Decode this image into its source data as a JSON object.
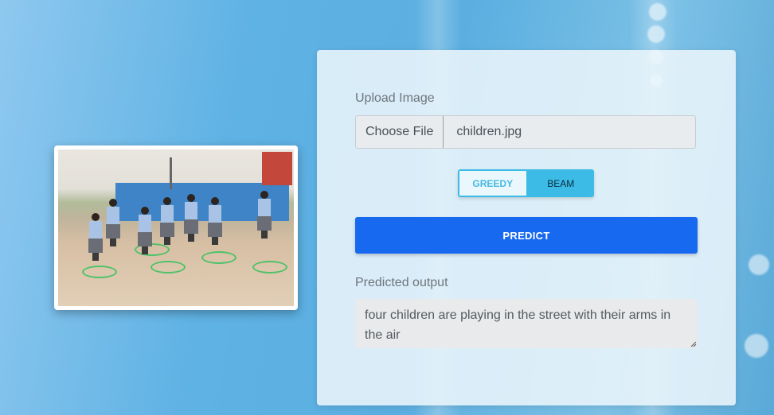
{
  "upload": {
    "label": "Upload Image",
    "button_label": "Choose File",
    "file_name": "children.jpg"
  },
  "mode": {
    "options": [
      "GREEDY",
      "BEAM"
    ],
    "selected": "BEAM"
  },
  "predict_button": "PREDICT",
  "output": {
    "label": "Predicted output",
    "text": "four children are playing in the street with their arms in the air"
  },
  "colors": {
    "accent": "#1769f0",
    "toggle": "#3bbbe6"
  }
}
